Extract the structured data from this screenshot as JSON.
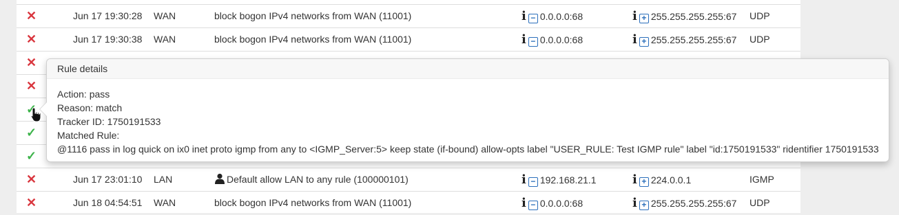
{
  "rows": [
    {
      "action": "block",
      "icon": "✕",
      "time": "Jun 17 19:30:28",
      "iface": "WAN",
      "rule": "block bogon IPv4 networks from WAN (11001)",
      "src": "0.0.0.0:68",
      "dst": "255.255.255.255:67",
      "proto": "UDP"
    },
    {
      "action": "block",
      "icon": "✕",
      "time": "Jun 17 19:30:38",
      "iface": "WAN",
      "rule": "block bogon IPv4 networks from WAN (11001)",
      "src": "0.0.0.0:68",
      "dst": "255.255.255.255:67",
      "proto": "UDP"
    },
    {
      "action": "block",
      "icon": "✕"
    },
    {
      "action": "block",
      "icon": "✕"
    },
    {
      "action": "pass",
      "icon": "✓"
    },
    {
      "action": "pass",
      "icon": "✓"
    },
    {
      "action": "pass",
      "icon": "✓"
    },
    {
      "action": "block",
      "icon": "✕",
      "time": "Jun 17 23:01:10",
      "iface": "LAN",
      "rule": "Default allow LAN to any rule (100000101)",
      "src": "192.168.21.1",
      "dst": "224.0.0.1",
      "proto": "IGMP"
    },
    {
      "action": "block",
      "icon": "✕",
      "time": "Jun 18 04:54:51",
      "iface": "WAN",
      "rule": "block bogon IPv4 networks from WAN (11001)",
      "src": "0.0.0.0:68",
      "dst": "255.255.255.255:67",
      "proto": "UDP"
    }
  ],
  "glyphs": {
    "info": "i",
    "minus": "−",
    "plus": "+"
  },
  "popover": {
    "title": "Rule details",
    "action": "Action: pass",
    "reason": "Reason: match",
    "tracker": "Tracker ID: 1750191533",
    "matched_label": "Matched Rule:",
    "matched_rule": "@1116 pass in log quick on ix0 inet proto igmp from any to <IGMP_Server:5> keep state (if-bound) allow-opts label \"USER_RULE: Test IGMP rule\" label \"id:1750191533\" ridentifier 1750191533"
  }
}
